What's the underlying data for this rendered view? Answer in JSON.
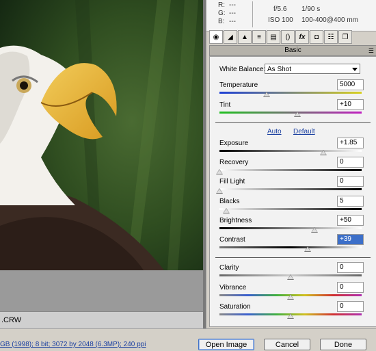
{
  "filename": ".CRW",
  "status_link": "GB (1998); 8 bit; 3072 by 2048 (6.3MP); 240 ppi",
  "info": {
    "r_label": "R:",
    "g_label": "G:",
    "b_label": "B:",
    "r_value": "---",
    "g_value": "---",
    "b_value": "---",
    "aperture": "f/5.6",
    "shutter": "1/90 s",
    "iso": "ISO 100",
    "lens": "100-400@400 mm"
  },
  "tabs": [
    "basic-tab",
    "tone-curve-tab",
    "detail-tab",
    "hsl-tab",
    "split-toning-tab",
    "lens-tab",
    "fx-tab",
    "camera-calibration-tab",
    "presets-tab",
    "snapshots-tab"
  ],
  "panel_title": "Basic",
  "white_balance": {
    "label": "White Balance:",
    "value": "As Shot"
  },
  "auto_label": "Auto",
  "default_label": "Default",
  "sliders": {
    "temperature": {
      "label": "Temperature",
      "value": "5000",
      "pos": 0.33
    },
    "tint": {
      "label": "Tint",
      "value": "+10",
      "pos": 0.55
    },
    "exposure": {
      "label": "Exposure",
      "value": "+1.85",
      "pos": 0.73
    },
    "recovery": {
      "label": "Recovery",
      "value": "0",
      "pos": 0.0
    },
    "fill_light": {
      "label": "Fill Light",
      "value": "0",
      "pos": 0.0
    },
    "blacks": {
      "label": "Blacks",
      "value": "5",
      "pos": 0.05
    },
    "brightness": {
      "label": "Brightness",
      "value": "+50",
      "pos": 0.67
    },
    "contrast": {
      "label": "Contrast",
      "value": "+39",
      "pos": 0.62
    },
    "clarity": {
      "label": "Clarity",
      "value": "0",
      "pos": 0.5
    },
    "vibrance": {
      "label": "Vibrance",
      "value": "0",
      "pos": 0.5
    },
    "saturation": {
      "label": "Saturation",
      "value": "0",
      "pos": 0.5
    }
  },
  "buttons": {
    "open_image": "Open Image",
    "cancel": "Cancel",
    "done": "Done"
  }
}
